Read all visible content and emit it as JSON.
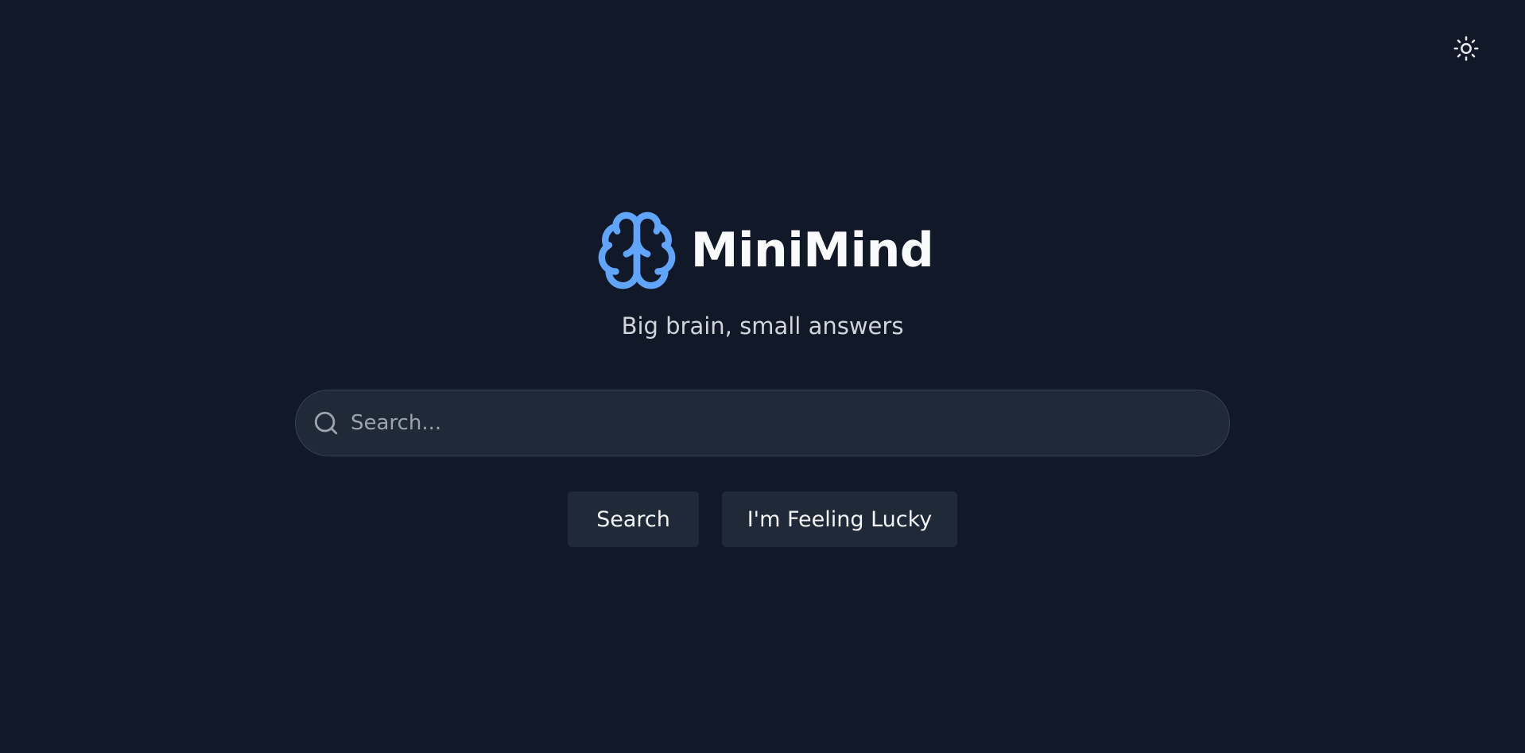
{
  "header": {
    "theme_toggle_icon": "sun-icon"
  },
  "brand": {
    "logo_icon": "brain-icon",
    "name": "MiniMind",
    "tagline": "Big brain, small answers",
    "accent_color": "#60a5fa"
  },
  "search": {
    "icon": "search-icon",
    "value": "",
    "placeholder": "Search..."
  },
  "actions": {
    "search_label": "Search",
    "lucky_label": "I'm Feeling Lucky"
  },
  "colors": {
    "background": "#111827",
    "surface": "#1f2937",
    "border": "#374151",
    "text": "#f9fafb",
    "muted": "#9ca3af"
  }
}
